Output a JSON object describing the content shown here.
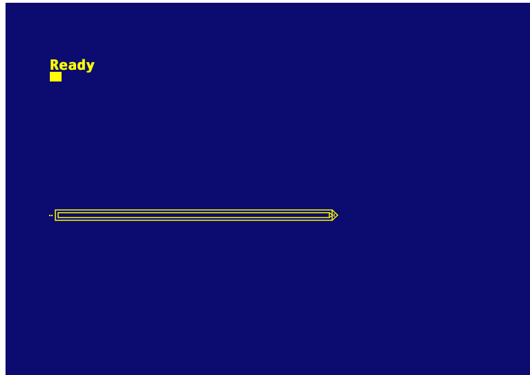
{
  "screen": {
    "prompt_text": "Ready",
    "background_color": "#0c0c70",
    "text_color": "#ffff00"
  },
  "cursor": {
    "icon": "block-cursor-icon"
  },
  "progress_bar": {
    "icon": "pencil-shaped-bar-icon",
    "color": "#ffff00"
  }
}
